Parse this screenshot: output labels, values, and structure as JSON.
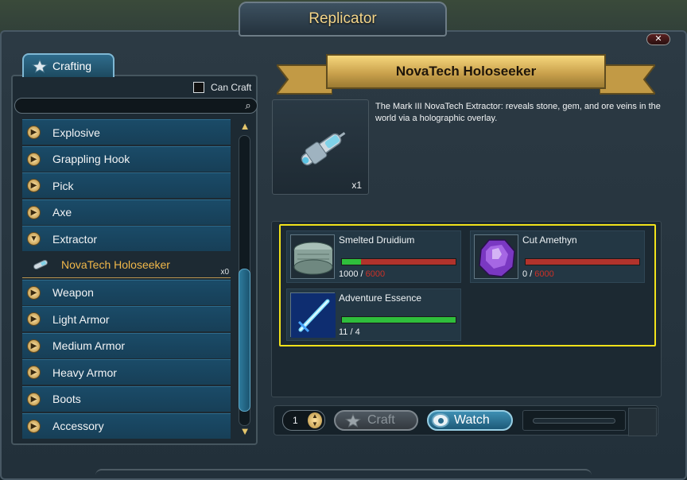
{
  "window": {
    "title": "Replicator",
    "close_icon": "close-icon"
  },
  "left": {
    "tab_label": "Crafting",
    "can_craft_label": "Can Craft",
    "search_placeholder": "",
    "categories": [
      {
        "label": "Explosive",
        "icon": "arrow-right-icon"
      },
      {
        "label": "Grappling Hook",
        "icon": "arrow-right-icon"
      },
      {
        "label": "Pick",
        "icon": "arrow-right-icon"
      },
      {
        "label": "Axe",
        "icon": "arrow-right-icon"
      },
      {
        "label": "Extractor",
        "icon": "arrow-down-icon"
      },
      {
        "label": "NovaTech Holoseeker",
        "count": "x0",
        "selected": true
      },
      {
        "label": "Weapon",
        "icon": "arrow-right-icon"
      },
      {
        "label": "Light Armor",
        "icon": "arrow-right-icon"
      },
      {
        "label": "Medium Armor",
        "icon": "arrow-right-icon"
      },
      {
        "label": "Heavy Armor",
        "icon": "arrow-right-icon"
      },
      {
        "label": "Boots",
        "icon": "arrow-right-icon"
      },
      {
        "label": "Accessory",
        "icon": "arrow-right-icon"
      }
    ]
  },
  "detail": {
    "item_name": "NovaTech Holoseeker",
    "item_quantity": "x1",
    "description": "The Mark III NovaTech Extractor: reveals stone, gem, and ore veins in the world via a holographic overlay.",
    "materials": [
      {
        "name": "Smelted Druidium",
        "have": "1000",
        "separator": " / ",
        "need": "6000",
        "fraction": 0.167,
        "icon": "druidium-ingot-icon"
      },
      {
        "name": "Cut Amethyn",
        "have": "0",
        "separator": " / ",
        "need": "6000",
        "fraction": 0.0,
        "icon": "amethyn-gem-icon"
      },
      {
        "name": "Adventure Essence",
        "have": "11",
        "separator": " / ",
        "need": "4",
        "fraction": 1.0,
        "icon": "essence-sword-icon"
      }
    ]
  },
  "actions": {
    "quantity": "1",
    "craft_label": "Craft",
    "watch_label": "Watch"
  },
  "colors": {
    "accent_gold": "#f1b84a",
    "highlight": "#f2e21a",
    "bar_have": "#2fbe3c",
    "bar_missing": "#b1332c",
    "required_text": "#cc3026"
  }
}
